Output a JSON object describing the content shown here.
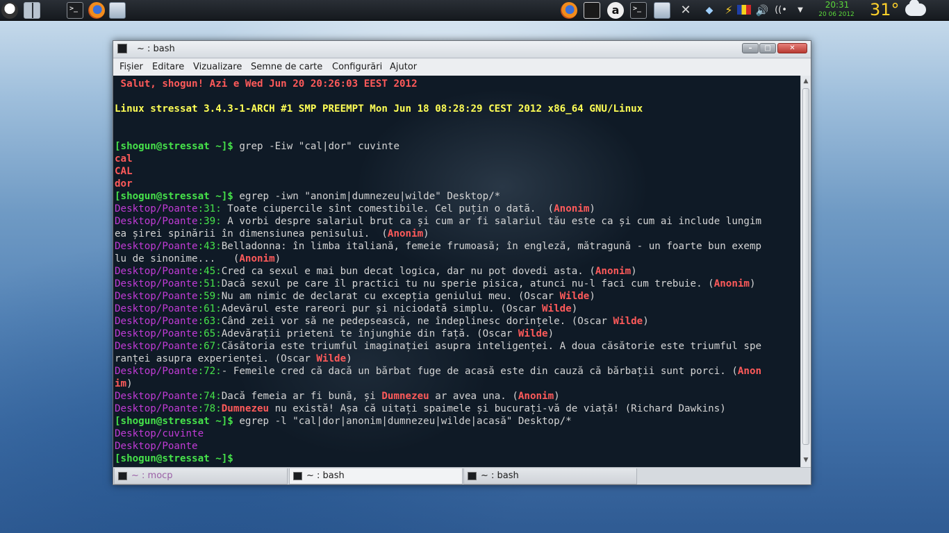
{
  "panel": {
    "clock_time": "20:31",
    "clock_date": "20 06 2012",
    "temperature": "31°",
    "icons": [
      "mascot-icon",
      "desktop-grid-icon",
      "terminal-icon",
      "firefox-icon",
      "document-icon",
      "firefox-icon",
      "notes-icon",
      "a-icon",
      "terminal-icon",
      "file-manager-icon",
      "settings-tools-icon",
      "dropbox-icon",
      "power-icon",
      "flag-icon",
      "volume-icon",
      "wifi-icon",
      "dropdown-icon",
      "weather-cloud-icon"
    ]
  },
  "window": {
    "title": "~ : bash",
    "menu": [
      "Fișier",
      "Editare",
      "Vizualizare",
      "Semne de carte",
      "Configurări",
      "Ajutor"
    ],
    "buttons": {
      "minimize": "–",
      "maximize": "□",
      "close": "✕"
    }
  },
  "terminal": {
    "lines": [
      [
        {
          "t": " Salut, shogun! Azi e Wed Jun 20 20:26:03 EEST 2012",
          "c": "red"
        }
      ],
      [],
      [
        {
          "t": "Linux stressat 3.4.3-1-ARCH #1 SMP PREEMPT Mon Jun 18 08:28:29 CEST 2012 x86_64 GNU/Linux",
          "c": "yellow"
        }
      ],
      [],
      [],
      [
        {
          "t": "[shogun@stressat ~]$",
          "c": "prompt"
        },
        {
          "t": " grep -Eiw \"cal|dor\" cuvinte",
          "c": ""
        }
      ],
      [
        {
          "t": "cal",
          "c": "red"
        }
      ],
      [
        {
          "t": "CAL",
          "c": "red"
        }
      ],
      [
        {
          "t": "dor",
          "c": "red"
        }
      ],
      [
        {
          "t": "[shogun@stressat ~]$",
          "c": "prompt"
        },
        {
          "t": " egrep -iwn \"anonim|dumnezeu|wilde\" Desktop/*",
          "c": ""
        }
      ],
      [
        {
          "t": "Desktop/Poante",
          "c": "mag"
        },
        {
          "t": ":31:",
          "c": "grn"
        },
        {
          "t": " Toate ciupercile sînt comestibile. Cel puțin o dată.  (",
          "c": ""
        },
        {
          "t": "Anonim",
          "c": "red"
        },
        {
          "t": ")",
          "c": ""
        }
      ],
      [
        {
          "t": "Desktop/Poante",
          "c": "mag"
        },
        {
          "t": ":39:",
          "c": "grn"
        },
        {
          "t": " A vorbi despre salariul brut ca și cum ar fi salariul tău este ca și cum ai include lungim",
          "c": ""
        }
      ],
      [
        {
          "t": "ea șirei spinării în dimensiunea penisului.  (",
          "c": ""
        },
        {
          "t": "Anonim",
          "c": "red"
        },
        {
          "t": ")",
          "c": ""
        }
      ],
      [
        {
          "t": "Desktop/Poante",
          "c": "mag"
        },
        {
          "t": ":43:",
          "c": "grn"
        },
        {
          "t": "Belladonna: în limba italiană, femeie frumoasă; în engleză, mătragună - un foarte bun exemp",
          "c": ""
        }
      ],
      [
        {
          "t": "lu de sinonime...   (",
          "c": ""
        },
        {
          "t": "Anonim",
          "c": "red"
        },
        {
          "t": ")",
          "c": ""
        }
      ],
      [
        {
          "t": "Desktop/Poante",
          "c": "mag"
        },
        {
          "t": ":45:",
          "c": "grn"
        },
        {
          "t": "Cred ca sexul e mai bun decat logica, dar nu pot dovedi asta. (",
          "c": ""
        },
        {
          "t": "Anonim",
          "c": "red"
        },
        {
          "t": ")",
          "c": ""
        }
      ],
      [
        {
          "t": "Desktop/Poante",
          "c": "mag"
        },
        {
          "t": ":51:",
          "c": "grn"
        },
        {
          "t": "Dacă sexul pe care îl practici tu nu sperie pisica, atunci nu-l faci cum trebuie. (",
          "c": ""
        },
        {
          "t": "Anonim",
          "c": "red"
        },
        {
          "t": ")",
          "c": ""
        }
      ],
      [
        {
          "t": "Desktop/Poante",
          "c": "mag"
        },
        {
          "t": ":59:",
          "c": "grn"
        },
        {
          "t": "Nu am nimic de declarat cu excepția geniului meu. (Oscar ",
          "c": ""
        },
        {
          "t": "Wilde",
          "c": "red"
        },
        {
          "t": ")",
          "c": ""
        }
      ],
      [
        {
          "t": "Desktop/Poante",
          "c": "mag"
        },
        {
          "t": ":61:",
          "c": "grn"
        },
        {
          "t": "Adevărul este rareori pur și niciodată simplu. (Oscar ",
          "c": ""
        },
        {
          "t": "Wilde",
          "c": "red"
        },
        {
          "t": ")",
          "c": ""
        }
      ],
      [
        {
          "t": "Desktop/Poante",
          "c": "mag"
        },
        {
          "t": ":63:",
          "c": "grn"
        },
        {
          "t": "Când zeii vor să ne pedepsească, ne îndeplinesc dorințele. (Oscar ",
          "c": ""
        },
        {
          "t": "Wilde",
          "c": "red"
        },
        {
          "t": ")",
          "c": ""
        }
      ],
      [
        {
          "t": "Desktop/Poante",
          "c": "mag"
        },
        {
          "t": ":65:",
          "c": "grn"
        },
        {
          "t": "Adevărații prieteni te înjunghie din față. (Oscar ",
          "c": ""
        },
        {
          "t": "Wilde",
          "c": "red"
        },
        {
          "t": ")",
          "c": ""
        }
      ],
      [
        {
          "t": "Desktop/Poante",
          "c": "mag"
        },
        {
          "t": ":67:",
          "c": "grn"
        },
        {
          "t": "Căsătoria este triumful imaginației asupra inteligenței. A doua căsătorie este triumful spe",
          "c": ""
        }
      ],
      [
        {
          "t": "ranței asupra experienței. (Oscar ",
          "c": ""
        },
        {
          "t": "Wilde",
          "c": "red"
        },
        {
          "t": ")",
          "c": ""
        }
      ],
      [
        {
          "t": "Desktop/Poante",
          "c": "mag"
        },
        {
          "t": ":72:",
          "c": "grn"
        },
        {
          "t": "- Femeile cred că dacă un bărbat fuge de acasă este din cauză că bărbații sunt porci. (",
          "c": ""
        },
        {
          "t": "Anon",
          "c": "red"
        }
      ],
      [
        {
          "t": "im",
          "c": "red"
        },
        {
          "t": ")",
          "c": ""
        }
      ],
      [
        {
          "t": "Desktop/Poante",
          "c": "mag"
        },
        {
          "t": ":74:",
          "c": "grn"
        },
        {
          "t": "Dacă femeia ar fi bună, și ",
          "c": ""
        },
        {
          "t": "Dumnezeu",
          "c": "red"
        },
        {
          "t": " ar avea una. (",
          "c": ""
        },
        {
          "t": "Anonim",
          "c": "red"
        },
        {
          "t": ")",
          "c": ""
        }
      ],
      [
        {
          "t": "Desktop/Poante",
          "c": "mag"
        },
        {
          "t": ":78:",
          "c": "grn"
        },
        {
          "t": "Dumnezeu",
          "c": "red"
        },
        {
          "t": " nu există! Așa că uitați spaimele și bucurați-vă de viață! (Richard Dawkins)",
          "c": ""
        }
      ],
      [
        {
          "t": "[shogun@stressat ~]$",
          "c": "prompt"
        },
        {
          "t": " egrep -l \"cal|dor|anonim|dumnezeu|wilde|acasă\" Desktop/*",
          "c": ""
        }
      ],
      [
        {
          "t": "Desktop/cuvinte",
          "c": "mag"
        }
      ],
      [
        {
          "t": "Desktop/Poante",
          "c": "mag"
        }
      ],
      [
        {
          "t": "[shogun@stressat ~]$",
          "c": "prompt"
        }
      ]
    ]
  },
  "tabs": [
    {
      "label": "~ : mocp",
      "dim": true
    },
    {
      "label": "~ : bash",
      "active": true
    },
    {
      "label": "~ : bash"
    }
  ]
}
